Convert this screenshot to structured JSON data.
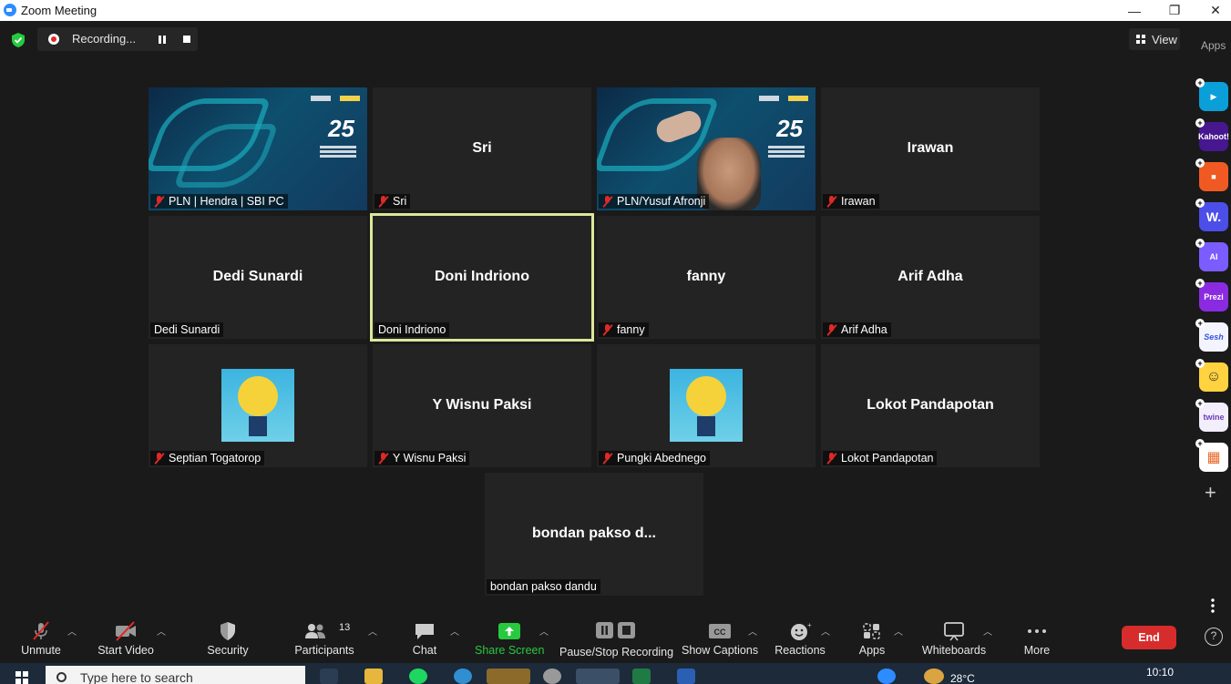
{
  "window": {
    "title": "Zoom Meeting",
    "minimize": "—",
    "maximize": "❐",
    "close": "✕"
  },
  "recording": {
    "label": "Recording..."
  },
  "view": {
    "label": "View"
  },
  "apps_panel": {
    "label": "Apps"
  },
  "participants": [
    {
      "display": "",
      "tag": "PLN | Hendra | SBI PC",
      "muted": true,
      "video": "banner"
    },
    {
      "display": "Sri",
      "tag": "Sri",
      "muted": true,
      "video": "none"
    },
    {
      "display": "",
      "tag": "PLN/Yusuf Afronji",
      "muted": true,
      "video": "camera"
    },
    {
      "display": "Irawan",
      "tag": "Irawan",
      "muted": true,
      "video": "none"
    },
    {
      "display": "Dedi Sunardi",
      "tag": "Dedi Sunardi",
      "muted": false,
      "video": "none"
    },
    {
      "display": "Doni Indriono",
      "tag": "Doni Indriono",
      "muted": false,
      "video": "none",
      "active_speaker": true
    },
    {
      "display": "fanny",
      "tag": "fanny",
      "muted": true,
      "video": "none"
    },
    {
      "display": "Arif Adha",
      "tag": "Arif Adha",
      "muted": true,
      "video": "none"
    },
    {
      "display": "",
      "tag": "Septian Togatorop",
      "muted": true,
      "video": "avatar"
    },
    {
      "display": "Y Wisnu Paksi",
      "tag": "Y Wisnu Paksi",
      "muted": true,
      "video": "none"
    },
    {
      "display": "",
      "tag": "Pungki Abednego",
      "muted": true,
      "video": "avatar"
    },
    {
      "display": "Lokot Pandapotan",
      "tag": "Lokot Pandapotan",
      "muted": true,
      "video": "none"
    },
    {
      "display": "bondan pakso d...",
      "tag": "bondan pakso dandu",
      "muted": false,
      "video": "none"
    }
  ],
  "side_apps": [
    {
      "name": "app-1",
      "label": "▶",
      "color": "#0a9fd9"
    },
    {
      "name": "kahoot",
      "label": "Kahoot!",
      "color": "#46178f"
    },
    {
      "name": "app-3",
      "label": "■",
      "color": "#f05a22"
    },
    {
      "name": "wordwall",
      "label": "W.",
      "color": "#4b4ee8"
    },
    {
      "name": "ai-app",
      "label": "AI",
      "color": "#7b5cff"
    },
    {
      "name": "prezi",
      "label": "Prezi",
      "color": "#8a2be2"
    },
    {
      "name": "sesh",
      "label": "Sesh",
      "color": "#f4f4ff"
    },
    {
      "name": "emoji-app",
      "label": "☺",
      "color": "#ffd23f"
    },
    {
      "name": "twine",
      "label": "twine",
      "color": "#f3eefc"
    },
    {
      "name": "app-10",
      "label": "▦",
      "color": "#ffffff"
    }
  ],
  "toolbar": {
    "unmute": "Unmute",
    "start_video": "Start Video",
    "security": "Security",
    "participants": "Participants",
    "participant_count": "13",
    "chat": "Chat",
    "share_screen": "Share Screen",
    "pause_stop_recording": "Pause/Stop Recording",
    "show_captions": "Show Captions",
    "reactions": "Reactions",
    "apps": "Apps",
    "whiteboards": "Whiteboards",
    "more": "More",
    "end": "End",
    "help": "?"
  },
  "taskbar": {
    "search_placeholder": "Type here to search",
    "temperature": "28°C",
    "time": "10:10"
  },
  "colors": {
    "accent_green": "#27c93f",
    "end_red": "#d72c2c",
    "active_border": "#dde79a"
  }
}
